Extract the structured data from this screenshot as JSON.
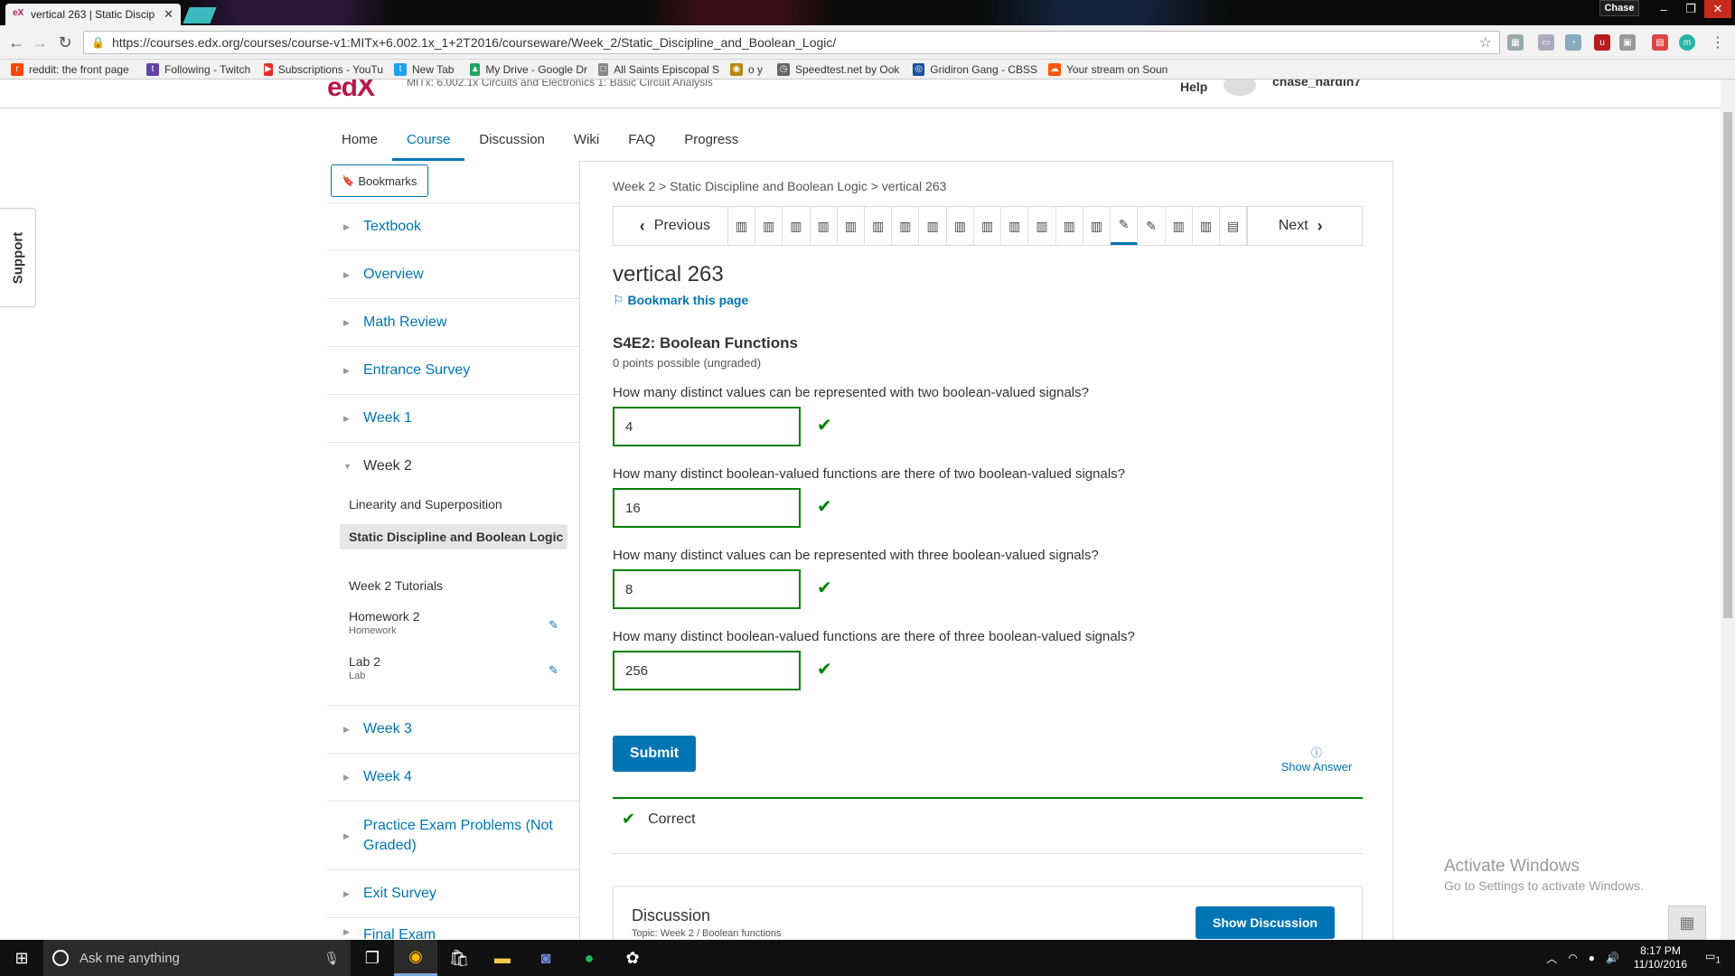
{
  "browser": {
    "tab_title": "vertical 263 | Static Discip",
    "tab_favicon": "eX",
    "url": "https://courses.edx.org/courses/course-v1:MITx+6.002.1x_1+2T2016/courseware/Week_2/Static_Discipline_and_Boolean_Logic/",
    "user_chip": "Chase",
    "bookmarks": [
      {
        "label": "reddit: the front page",
        "color": "#ff4500",
        "icon": "r"
      },
      {
        "label": "Following - Twitch",
        "color": "#6441a5",
        "icon": "t"
      },
      {
        "label": "Subscriptions - YouTu",
        "color": "#e52d27",
        "icon": "▶"
      },
      {
        "label": "New Tab",
        "color": "#1da1f2",
        "icon": "t"
      },
      {
        "label": "My Drive - Google Dr",
        "color": "#1fa463",
        "icon": "▲"
      },
      {
        "label": "All Saints Episcopal S",
        "color": "#888888",
        "icon": "□"
      },
      {
        "label": "o y",
        "color": "#b8860b",
        "icon": "◉"
      },
      {
        "label": "Speedtest.net by Ook",
        "color": "#666666",
        "icon": "◷"
      },
      {
        "label": "Gridiron Gang - CBSS",
        "color": "#1a4fa0",
        "icon": "◎"
      },
      {
        "label": "Your stream on Soun",
        "color": "#ff5500",
        "icon": "☁"
      }
    ]
  },
  "header": {
    "logo": "edX",
    "course_partial": "MITx: 6.002.1x Circuits and Electronics 1: Basic Circuit Analysis",
    "help": "Help",
    "username": "chase_hardin7"
  },
  "course_nav": [
    "Home",
    "Course",
    "Discussion",
    "Wiki",
    "FAQ",
    "Progress"
  ],
  "support_label": "Support",
  "sidebar": {
    "bookmarks_label": "Bookmarks",
    "chapters": [
      "Textbook",
      "Overview",
      "Math Review",
      "Entrance Survey",
      "Week 1",
      "Week 2",
      "Week 3",
      "Week 4",
      "Practice Exam Problems (Not Graded)",
      "Exit Survey",
      "Final Exam"
    ],
    "week2_sections": [
      {
        "label": "Linearity and Superposition",
        "sub": ""
      },
      {
        "label": "Static Discipline and Boolean Logic",
        "sub": ""
      },
      {
        "label": "Week 2 Tutorials",
        "sub": ""
      },
      {
        "label": "Homework 2",
        "sub": "Homework"
      },
      {
        "label": "Lab 2",
        "sub": "Lab"
      }
    ]
  },
  "main": {
    "breadcrumbs": "Week 2 > Static Discipline and Boolean Logic > vertical 263",
    "prev_label": "Previous",
    "next_label": "Next",
    "seq_tabs": [
      "video",
      "video",
      "video",
      "video",
      "video",
      "video",
      "video",
      "video",
      "video",
      "video",
      "video",
      "video",
      "video",
      "video",
      "problem",
      "problem",
      "video",
      "video",
      "other"
    ],
    "unit_title": "vertical 263",
    "bookmark_page": "Bookmark this page",
    "problem_title": "S4E2: Boolean Functions",
    "points": "0 points possible (ungraded)",
    "questions": [
      {
        "text": "How many distinct values can be represented with two boolean-valued signals?",
        "answer": "4"
      },
      {
        "text": "How many distinct boolean-valued functions are there of two boolean-valued signals?",
        "answer": "16"
      },
      {
        "text": "How many distinct values can be represented with three boolean-valued signals?",
        "answer": "8"
      },
      {
        "text": "How many distinct boolean-valued functions are there of three boolean-valued signals?",
        "answer": "256"
      }
    ],
    "submit": "Submit",
    "show_answer": "Show Answer",
    "correct": "Correct",
    "discussion_title": "Discussion",
    "discussion_topic": "Topic: Week 2 / Boolean functions",
    "show_discussion": "Show Discussion"
  },
  "activate_windows": {
    "line1": "Activate Windows",
    "line2": "Go to Settings to activate Windows."
  },
  "taskbar": {
    "search_placeholder": "Ask me anything",
    "time": "8:17 PM",
    "date": "11/10/2016",
    "notifications": "1"
  },
  "colors": {
    "accent": "#0075b4",
    "correct": "#008100",
    "brand": "#b5184a"
  }
}
